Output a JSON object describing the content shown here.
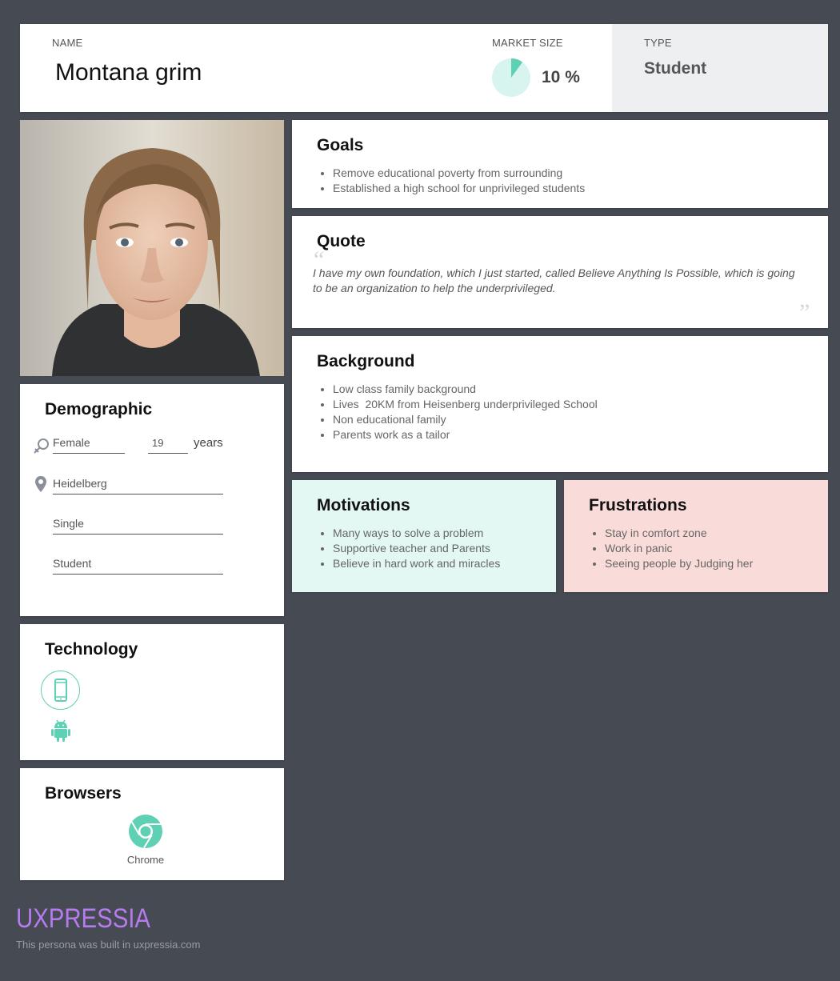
{
  "header": {
    "name_label": "NAME",
    "name": "Montana grim",
    "market_size_label": "MARKET SIZE",
    "market_size_value": "10 %",
    "market_size_fraction": 0.1,
    "type_label": "TYPE",
    "type": "Student"
  },
  "photo": {
    "description": "portrait-photo"
  },
  "demographic": {
    "title": "Demographic",
    "gender": "Female",
    "age": "19",
    "age_unit": "years",
    "location": "Heidelberg",
    "relationship": "Single",
    "occupation": "Student",
    "icons": [
      "gender-icon",
      "location-pin-icon"
    ]
  },
  "technology": {
    "title": "Technology",
    "icons": [
      "smartphone-icon",
      "android-icon"
    ]
  },
  "browsers": {
    "title": "Browsers",
    "items": [
      {
        "label": "Chrome",
        "icon": "chrome-icon"
      }
    ]
  },
  "goals": {
    "title": "Goals",
    "items": [
      "Remove educational poverty from surrounding",
      "Established a high school for unprivileged students"
    ]
  },
  "quote": {
    "title": "Quote",
    "text": "I have my own foundation, which I just started, called Believe Anything Is Possible, which is going to be an organization to help the underprivileged."
  },
  "background": {
    "title": "Background",
    "items": [
      "Low class family background",
      "Lives  20KM from Heisenberg underprivileged School",
      "Non educational family",
      "Parents work as a tailor"
    ]
  },
  "motivations": {
    "title": "Motivations",
    "items": [
      "Many ways to solve a problem",
      "Supportive teacher and Parents",
      "Believe in hard work and miracles"
    ]
  },
  "frustrations": {
    "title": "Frustrations",
    "items": [
      "Stay in comfort zone",
      "Work in panic",
      "Seeing people by Judging her"
    ]
  },
  "footer": {
    "brand": "UXPRESSIA",
    "note": "This persona was built in uxpressia.com"
  },
  "colors": {
    "background": "#464a53",
    "accent_teal": "#5ed0b4",
    "teal_light": "#d7f5ee",
    "motivations_bg": "#e3f7f3",
    "frustrations_bg": "#f9dcd9",
    "brand_purple": "#b77bf0"
  }
}
